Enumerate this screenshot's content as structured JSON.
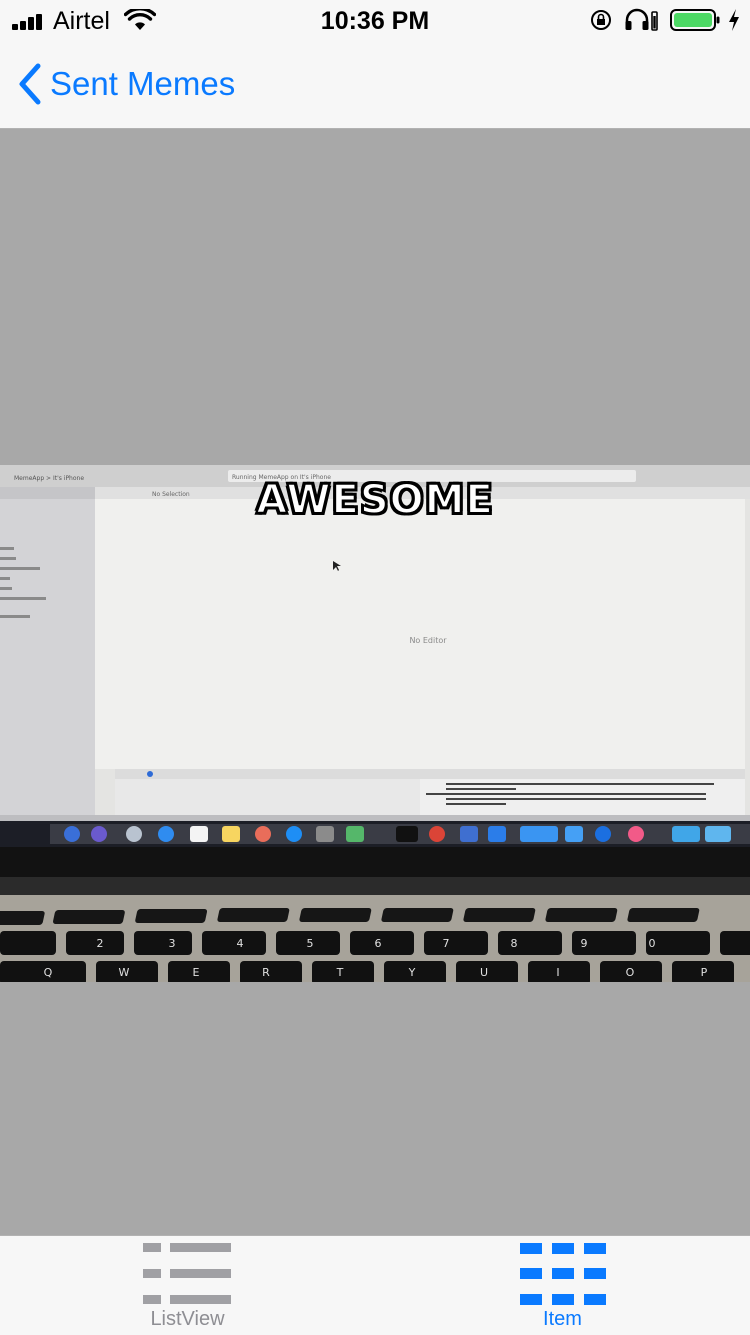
{
  "status_bar": {
    "carrier": "Airtel",
    "time": "10:36 PM",
    "battery_color": "#4cd964"
  },
  "nav": {
    "back_label": "Sent Memes",
    "accent": "#0a7aff"
  },
  "meme": {
    "caption": "AWESOME",
    "photo_subject": "laptop screen photo",
    "screen_text": {
      "top_bar": "MemeApp > It's iPhone",
      "status": "Running MemeApp on It's iPhone",
      "selection": "No Selection",
      "editor": "No Editor"
    }
  },
  "tab_bar": {
    "tabs": [
      {
        "label": "ListView",
        "icon": "list-icon",
        "selected": false
      },
      {
        "label": "Item",
        "icon": "grid-icon",
        "selected": true
      }
    ],
    "active_color": "#0a7aff",
    "inactive_color": "#8e8e93"
  }
}
